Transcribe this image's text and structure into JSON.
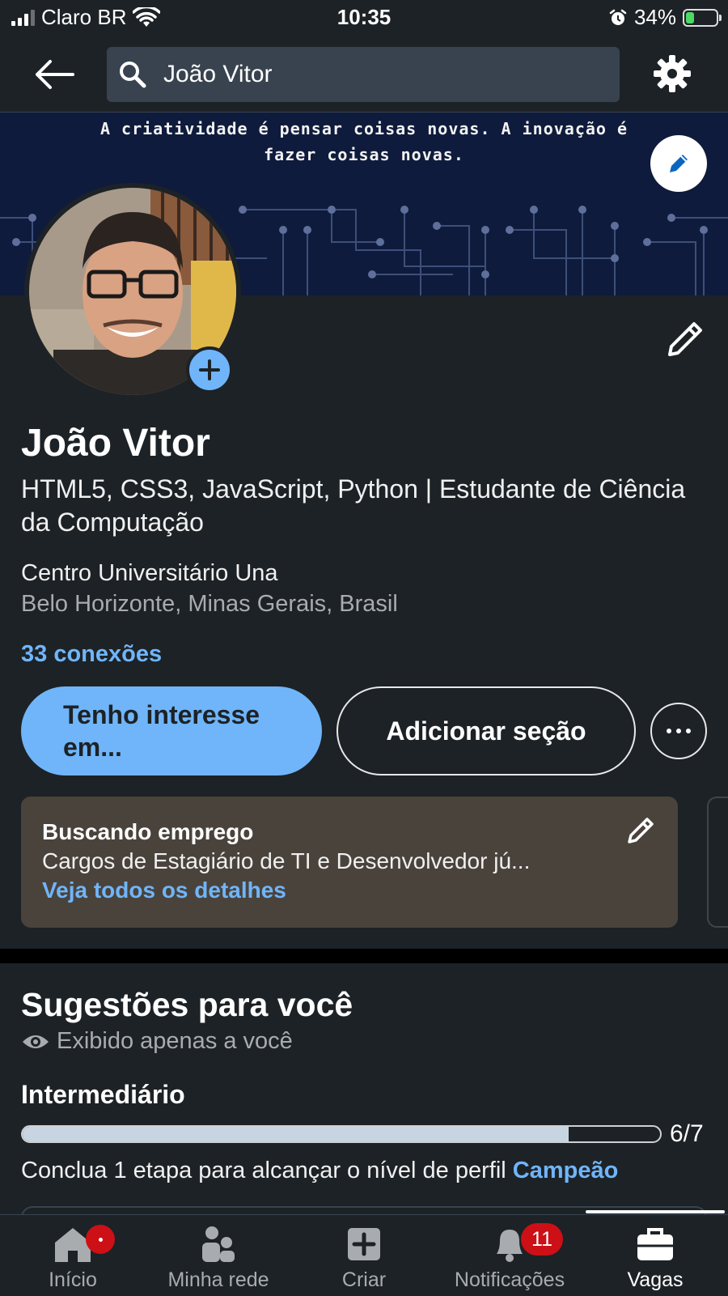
{
  "status_bar": {
    "carrier": "Claro BR",
    "time": "10:35",
    "battery_percent": "34%",
    "battery_level": 0.34,
    "icons": [
      "signal-icon",
      "wifi-icon",
      "alarm-icon",
      "battery-charging-icon"
    ]
  },
  "search": {
    "value": "João Vitor"
  },
  "banner": {
    "quote": "A criatividade é pensar coisas novas. A inovação é fazer coisas novas."
  },
  "profile": {
    "name": "João Vitor",
    "headline": "HTML5, CSS3, JavaScript, Python | Estudante de Ciência da Computação",
    "school": "Centro Universitário Una",
    "location": "Belo Horizonte, Minas Gerais, Brasil",
    "connections": "33 conexões"
  },
  "actions": {
    "primary": "Tenho interesse em...",
    "secondary": "Adicionar seção"
  },
  "open_to_work": {
    "title": "Buscando emprego",
    "text": "Cargos de Estagiário de TI e Desenvolvedor jú...",
    "link": "Veja todos os detalhes"
  },
  "suggestions": {
    "title": "Sugestões para você",
    "visibility": "Exibido apenas a você",
    "level": "Intermediário",
    "progress_value": 6,
    "progress_max": 7,
    "progress_label": "6/7",
    "note_prefix": "Conclua 1 etapa para alcançar o nível de perfil",
    "note_highlight": "Campeão"
  },
  "colors": {
    "background": "#1d2226",
    "accent": "#70b5f9",
    "banner": "#0f1b3c",
    "card": "#4a433c",
    "badge": "#cc1016"
  },
  "bottom_nav": {
    "items": [
      {
        "label": "Início",
        "icon": "home-icon"
      },
      {
        "label": "Minha rede",
        "icon": "network-icon"
      },
      {
        "label": "Criar",
        "icon": "create-plus-icon"
      },
      {
        "label": "Notificações",
        "icon": "bell-icon"
      },
      {
        "label": "Vagas",
        "icon": "briefcase-icon"
      }
    ],
    "notifications_badge": "11",
    "active": "Vagas"
  }
}
